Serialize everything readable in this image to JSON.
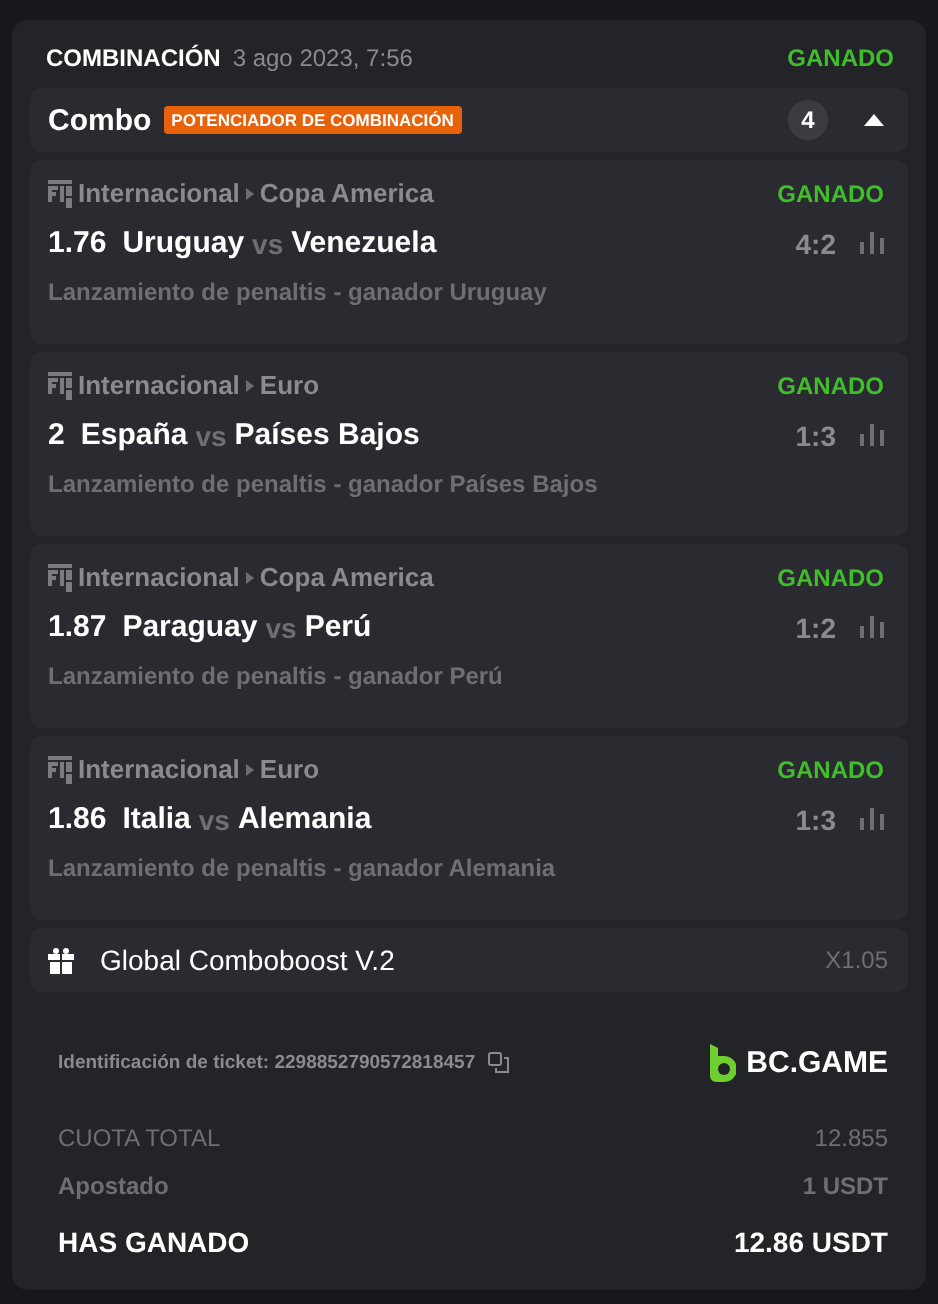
{
  "header": {
    "title": "COMBINACIÓN",
    "date": "3 ago 2023, 7:56",
    "status": "GANADO"
  },
  "combo": {
    "label": "Combo",
    "badge": "POTENCIADOR DE COMBINACIÓN",
    "count": "4",
    "expanded": true
  },
  "bets": [
    {
      "category": "Internacional",
      "league": "Copa America",
      "status": "GANADO",
      "odds": "1.76",
      "home": "Uruguay",
      "vs": "vs",
      "away": "Venezuela",
      "score": "4:2",
      "market": "Lanzamiento de penaltis - ganador Uruguay"
    },
    {
      "category": "Internacional",
      "league": "Euro",
      "status": "GANADO",
      "odds": "2",
      "home": "España",
      "vs": "vs",
      "away": "Países Bajos",
      "score": "1:3",
      "market": "Lanzamiento de penaltis - ganador Países Bajos"
    },
    {
      "category": "Internacional",
      "league": "Copa America",
      "status": "GANADO",
      "odds": "1.87",
      "home": "Paraguay",
      "vs": "vs",
      "away": "Perú",
      "score": "1:2",
      "market": "Lanzamiento de penaltis - ganador Perú"
    },
    {
      "category": "Internacional",
      "league": "Euro",
      "status": "GANADO",
      "odds": "1.86",
      "home": "Italia",
      "vs": "vs",
      "away": "Alemania",
      "score": "1:3",
      "market": "Lanzamiento de penaltis - ganador Alemania"
    }
  ],
  "boost": {
    "label": "Global Comboboost V.2",
    "multiplier": "X1.05"
  },
  "ticket": {
    "label": "Identificación de ticket: 2298852790572818457",
    "brand": "BC.GAME"
  },
  "summary": [
    {
      "kind": "muted",
      "label": "CUOTA TOTAL",
      "value": "12.855"
    },
    {
      "kind": "muted",
      "label": "Apostado",
      "value": "1 USDT"
    },
    {
      "kind": "strong",
      "label": "HAS GANADO",
      "value": "12.86 USDT"
    }
  ]
}
